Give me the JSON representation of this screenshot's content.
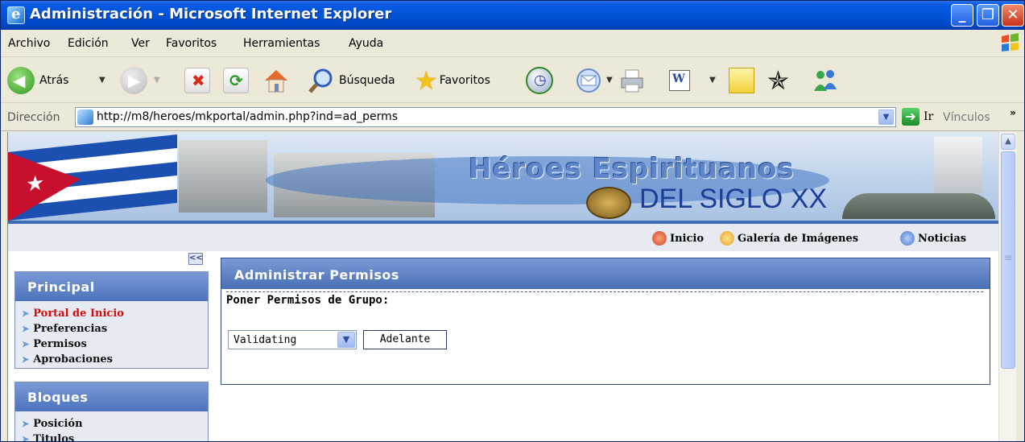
{
  "window": {
    "title": "Administración - Microsoft Internet Explorer",
    "controls": {
      "minimize": "_",
      "maximize": "❐",
      "close": "✕"
    }
  },
  "menu": [
    "Archivo",
    "Edición",
    "Ver",
    "Favoritos",
    "Herramientas",
    "Ayuda"
  ],
  "toolbar": {
    "back_label": "Atrás",
    "search_label": "Búsqueda",
    "favorites_label": "Favoritos",
    "icons": [
      "back-icon",
      "forward-icon",
      "stop-icon",
      "refresh-icon",
      "home-icon",
      "search-icon",
      "favorites-icon",
      "history-icon",
      "mail-icon",
      "print-icon",
      "word-icon",
      "notes-icon",
      "messenger-icon",
      "users-icon"
    ]
  },
  "address": {
    "label": "Dirección",
    "url": "http://m8/heroes/mkportal/admin.php?ind=ad_perms",
    "go_label": "Ir",
    "links_label": "Vínculos",
    "more": "»"
  },
  "banner": {
    "title_top": "Héroes Espirituanos",
    "title_bottom": "DEL SIGLO XX"
  },
  "nav": [
    {
      "label": "Inicio",
      "icon": "home-icon",
      "color": "#d04a2a"
    },
    {
      "label": "Galería de Imágenes",
      "icon": "gallery-icon",
      "color": "#e0a52a"
    },
    {
      "label": "Noticias",
      "icon": "news-icon",
      "color": "#4a7ad0"
    }
  ],
  "sidebar": {
    "collapse": "<<",
    "sections": [
      {
        "title": "Principal",
        "items": [
          {
            "label": "Portal de Inicio",
            "active": true
          },
          {
            "label": "Preferencias"
          },
          {
            "label": "Permisos"
          },
          {
            "label": "Aprobaciones"
          }
        ]
      },
      {
        "title": "Bloques",
        "items": [
          {
            "label": "Posición"
          },
          {
            "label": "Titulos"
          }
        ]
      }
    ]
  },
  "main": {
    "panel_title": "Administrar Permisos",
    "subtitle": "Poner Permisos de Grupo:",
    "group_select_value": "Validating",
    "submit_label": "Adelante"
  },
  "colors": {
    "accent": "#4c73bc",
    "active_link": "#d8080a",
    "titlebar": "#0052d6"
  }
}
